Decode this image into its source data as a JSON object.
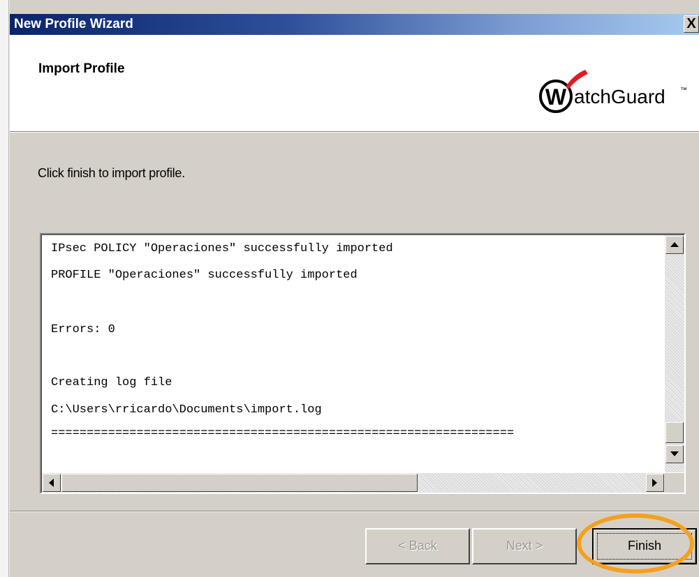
{
  "window": {
    "title": "New Profile Wizard",
    "close_label": "X"
  },
  "header": {
    "title": "Import Profile",
    "logo_text": "atchGuard",
    "logo_letter": "W",
    "logo_mark": "™"
  },
  "body": {
    "instruction": "Click finish to import profile."
  },
  "log": {
    "lines": [
      "IPsec POLICY \"Operaciones\" successfully imported",
      "PROFILE \"Operaciones\" successfully imported",
      "",
      "Errors: 0",
      "",
      "Creating log file",
      "C:\\Users\\rricardo\\Documents\\import.log",
      "================================================================="
    ]
  },
  "buttons": {
    "back_label": "< Back",
    "next_label": "Next >",
    "finish_label": "Finish"
  },
  "icons": {
    "scroll_up": "scroll-up-arrow-icon",
    "scroll_down": "scroll-down-arrow-icon",
    "scroll_left": "scroll-left-arrow-icon",
    "scroll_right": "scroll-right-arrow-icon"
  },
  "colors": {
    "titlebar_start": "#0a246a",
    "titlebar_end": "#a6caf0",
    "logo_red": "#e31b23",
    "highlight_ring": "#f5a01e"
  }
}
